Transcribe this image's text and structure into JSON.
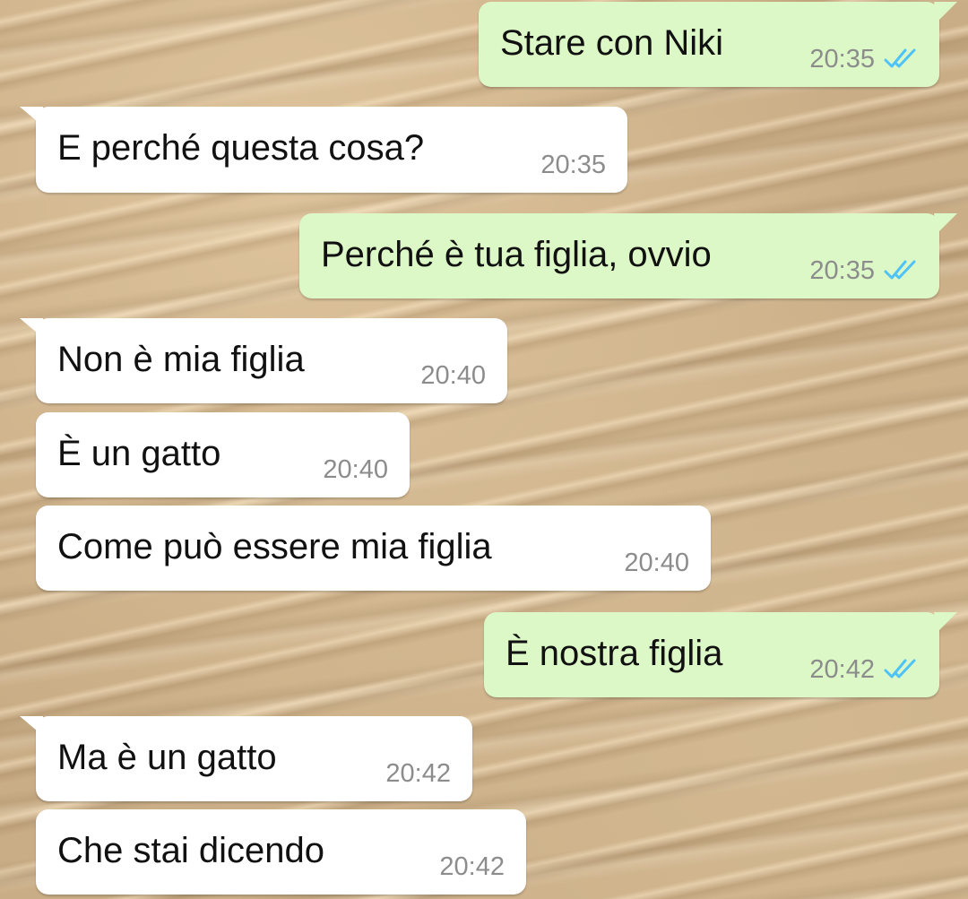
{
  "colors": {
    "incoming_bubble": "#ffffff",
    "outgoing_bubble": "#dcf8c6",
    "read_ticks": "#4fc3f7",
    "timestamp": "#8c8c8c"
  },
  "icons": {
    "read_receipt": "double-check-icon"
  },
  "messages": [
    {
      "direction": "outgoing",
      "text": "Stare con Niki",
      "time": "20:35",
      "status": "read"
    },
    {
      "direction": "incoming",
      "text": "E perché questa cosa?",
      "time": "20:35"
    },
    {
      "direction": "outgoing",
      "text": "Perché è tua figlia, ovvio",
      "time": "20:35",
      "status": "read"
    },
    {
      "direction": "incoming",
      "text": "Non è mia figlia",
      "time": "20:40"
    },
    {
      "direction": "incoming",
      "text": "È un gatto",
      "time": "20:40"
    },
    {
      "direction": "incoming",
      "text": "Come può essere mia figlia",
      "time": "20:40"
    },
    {
      "direction": "outgoing",
      "text": "È nostra figlia",
      "time": "20:42",
      "status": "read"
    },
    {
      "direction": "incoming",
      "text": "Ma è un gatto",
      "time": "20:42"
    },
    {
      "direction": "incoming",
      "text": "Che stai dicendo",
      "time": "20:42"
    }
  ]
}
